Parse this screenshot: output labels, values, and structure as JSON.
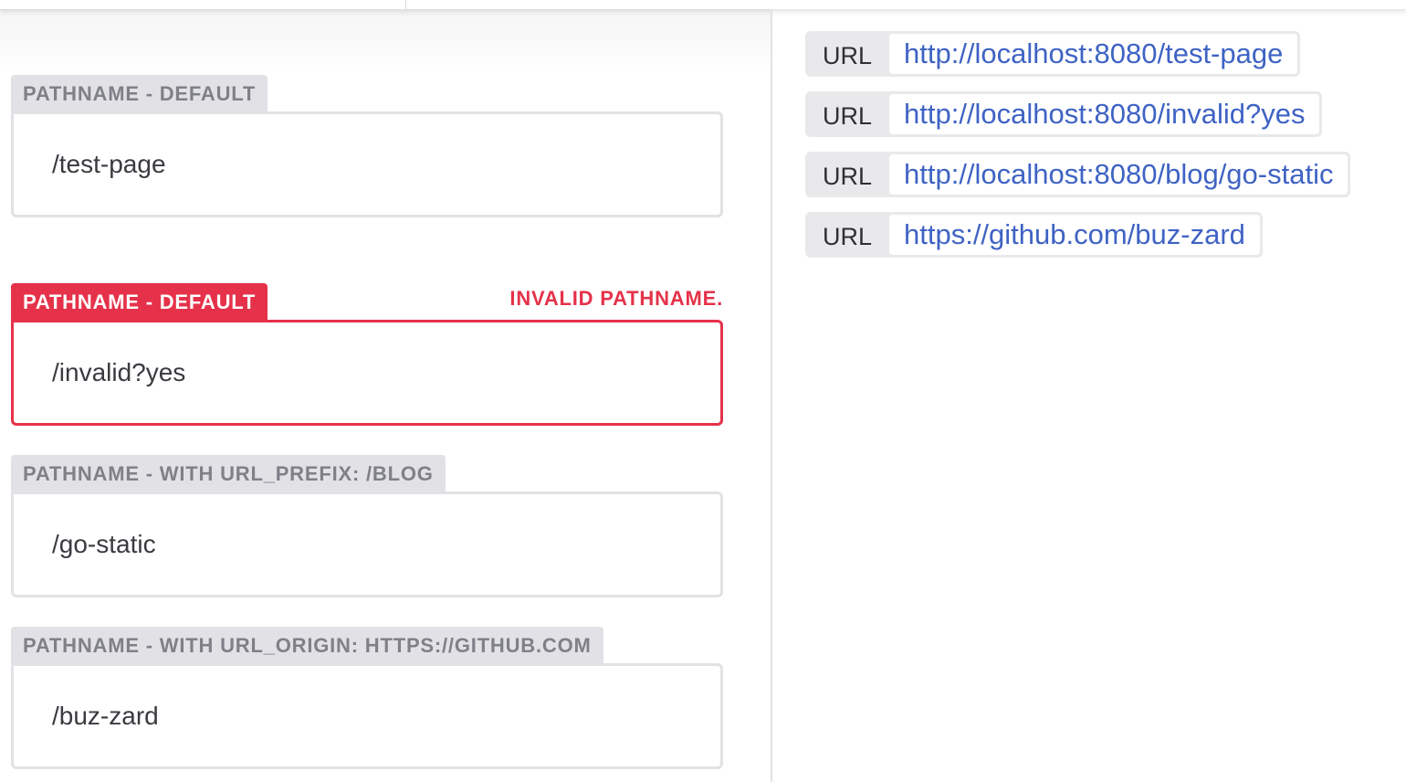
{
  "fields": [
    {
      "label": "PATHNAME - DEFAULT",
      "value": "/test-page",
      "invalid": false,
      "error": ""
    },
    {
      "label": "PATHNAME - DEFAULT",
      "value": "/invalid?yes",
      "invalid": true,
      "error": "INVALID PATHNAME."
    },
    {
      "label": "PATHNAME - WITH URL_PREFIX: /BLOG",
      "value": "/go-static",
      "invalid": false,
      "error": ""
    },
    {
      "label": "PATHNAME - WITH URL_ORIGIN: HTTPS://GITHUB.COM",
      "value": "/buz-zard",
      "invalid": false,
      "error": ""
    }
  ],
  "urls": [
    {
      "tag": "URL",
      "href": "http://localhost:8080/test-page"
    },
    {
      "tag": "URL",
      "href": "http://localhost:8080/invalid?yes"
    },
    {
      "tag": "URL",
      "href": "http://localhost:8080/blog/go-static"
    },
    {
      "tag": "URL",
      "href": "https://github.com/buz-zard"
    }
  ],
  "colors": {
    "error": "#e5324a",
    "link": "#3f63c4",
    "label_bg": "#e2e2e6",
    "label_text": "#7f8088"
  }
}
